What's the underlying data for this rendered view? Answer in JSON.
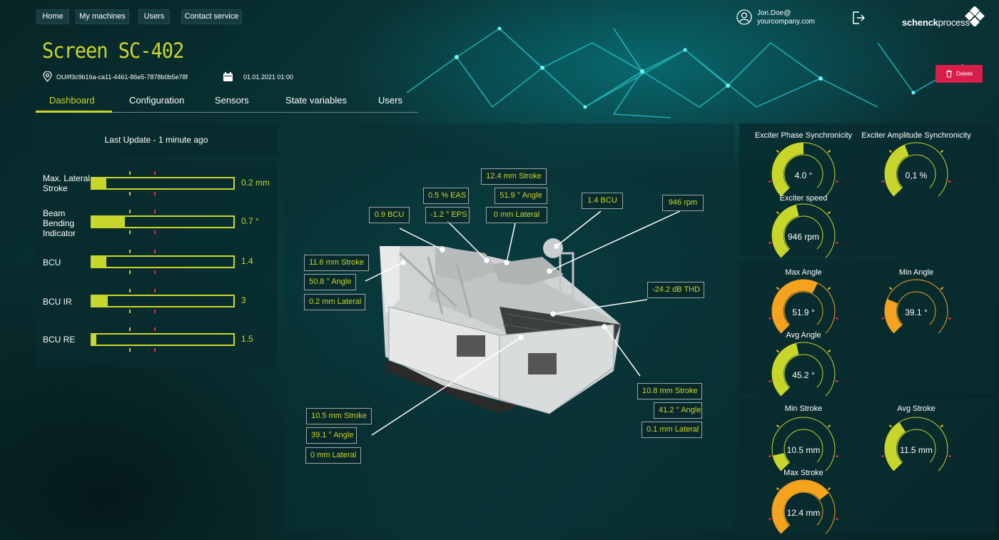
{
  "nav": {
    "home": "Home",
    "machines": "My machines",
    "users": "Users",
    "contact": "Contact service"
  },
  "user": {
    "line1": "Jon.Doe@",
    "line2": "yourcompany.com"
  },
  "brand": {
    "bold": "schenck",
    "rest": "process"
  },
  "page": {
    "title": "Screen SC-402",
    "id": "OU#f3c9b16a-ca11-4461-86e5-7878b0b5e78f",
    "date": "01.01.2021 01:00",
    "delete_label": "Delete"
  },
  "tabs": [
    "Dashboard",
    "Configuration",
    "Sensors",
    "State variables",
    "Users"
  ],
  "last_update": "Last Update - 1 minute ago",
  "bars": [
    {
      "label": "Max. Lateral Stroke",
      "value": "0.2 mm",
      "fill": 0.1
    },
    {
      "label": "Beam Bending Indicator",
      "value": "0.7 °",
      "fill": 0.23
    },
    {
      "label": "BCU",
      "value": "1.4",
      "fill": 0.1
    },
    {
      "label": "BCU IR",
      "value": "3",
      "fill": 0.11
    },
    {
      "label": "BCU RE",
      "value": "1.5",
      "fill": 0.03
    }
  ],
  "labels": {
    "top_stroke": "12.4 mm Stroke",
    "top_angle": "51.9 ° Angle",
    "top_lateral": "0 mm Lateral",
    "eas": "0.5 % EAS",
    "eps": "-1.2 ° EPS",
    "bcu_left": "0.9 BCU",
    "bcu_right": "1.4 BCU",
    "rpm": "946 rpm",
    "left_stroke": "11.6 mm Stroke",
    "left_angle": "50.8 ° Angle",
    "left_lateral": "0.2 mm Lateral",
    "thd": "-24.2 dB THD",
    "br_stroke": "10.8 mm Stroke",
    "br_angle": "41.2 ° Angle",
    "br_lateral": "0.1 mm Lateral",
    "bl_stroke": "10.5 mm Stroke",
    "bl_angle": "39.1 ° Angle",
    "bl_lateral": "0 mm Lateral"
  },
  "gauges": [
    {
      "title": "Exciter Phase Synchronicity",
      "value": "4.0 °",
      "level": 0.5,
      "color": "#c8d62b"
    },
    {
      "title": "Exciter Amplitude Synchronicity",
      "value": "0,1 %",
      "level": 0.42,
      "color": "#c8d62b"
    },
    {
      "title": "Exciter speed",
      "value": "946 rpm",
      "level": 0.45,
      "color": "#c8d62b"
    },
    {
      "title": "Max Angle",
      "value": "51.9 °",
      "level": 0.6,
      "color": "#f5a21e"
    },
    {
      "title": "Min Angle",
      "value": "39.1 °",
      "level": 0.25,
      "color": "#f5a21e"
    },
    {
      "title": "Avg Angle",
      "value": "45.2 °",
      "level": 0.45,
      "color": "#c8d62b"
    },
    {
      "title": "Min Stroke",
      "value": "10.5 mm",
      "level": 0.12,
      "color": "#c8d62b"
    },
    {
      "title": "Avg Stroke",
      "value": "11.5 mm",
      "level": 0.38,
      "color": "#c8d62b"
    },
    {
      "title": "Max Stroke",
      "value": "12.4 mm",
      "level": 0.7,
      "color": "#f5a21e"
    }
  ],
  "colors": {
    "accent": "#c8d62b",
    "warn": "#f5a21e",
    "danger": "#d81e4a",
    "tick_yellow": "#e8c21f",
    "tick_red": "#e0364a"
  }
}
